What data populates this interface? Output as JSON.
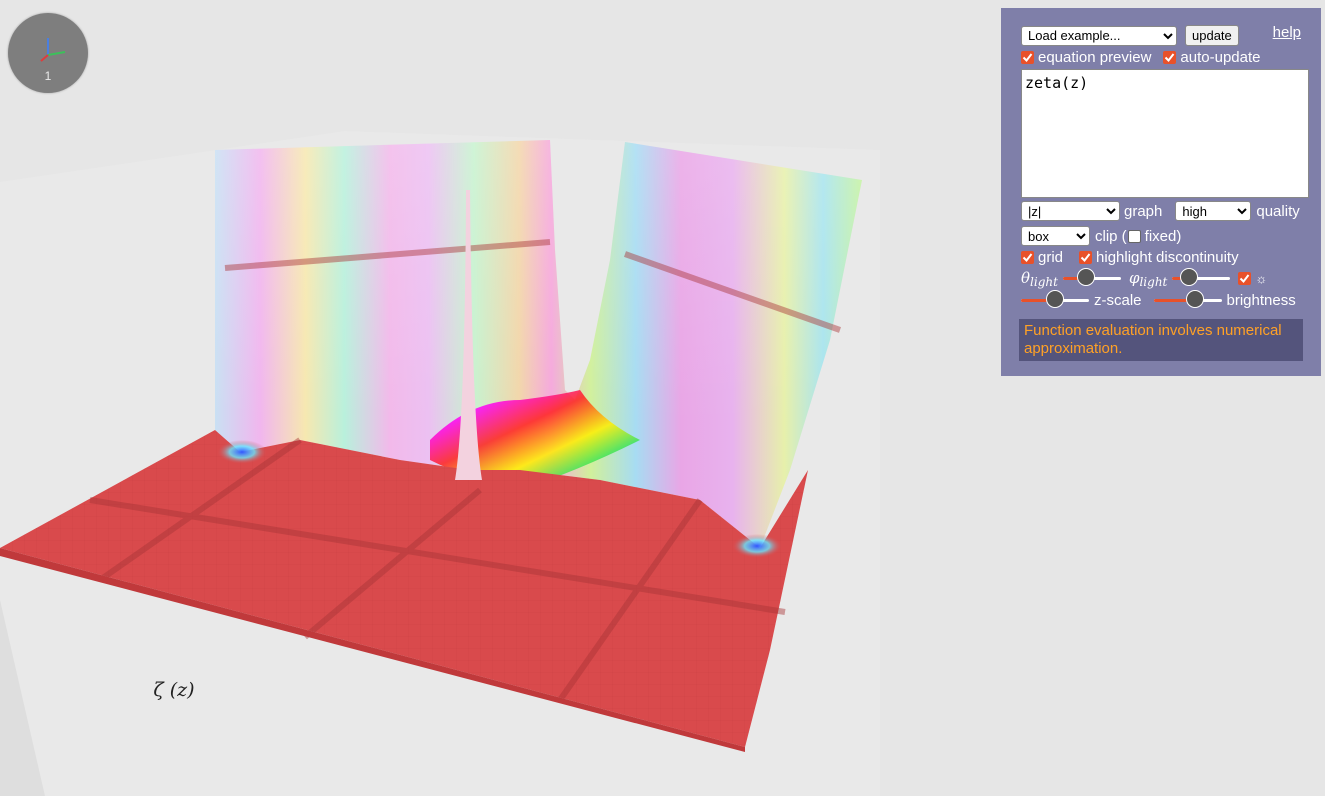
{
  "gizmo": {
    "zoom": "1"
  },
  "plot": {
    "equation_label": "ζ (z)",
    "floor_color": "#d94a4c",
    "background_color": "#e6e6e6"
  },
  "panel": {
    "bg_color": "#7f7fa9",
    "accent_color": "#e8512a",
    "help": "help",
    "example_select": "Load example...",
    "update_button": "update",
    "equation_preview": {
      "label": "equation preview",
      "checked": true
    },
    "auto_update": {
      "label": "auto-update",
      "checked": true
    },
    "equation": "zeta(z)",
    "graph_mode": {
      "value": "|z|",
      "label": "graph"
    },
    "quality": {
      "value": "high",
      "label": "quality"
    },
    "clip": {
      "value": "box",
      "label_before": "clip (",
      "fixed_label": "fixed)",
      "fixed_checked": false
    },
    "grid": {
      "label": "grid",
      "checked": true
    },
    "highlight_discontinuity": {
      "label": "highlight discontinuity",
      "checked": true
    },
    "theta_light": {
      "symbol": "θ",
      "subscript": "light",
      "value": 0.35
    },
    "phi_light": {
      "symbol": "φ",
      "subscript": "light",
      "value": 0.2
    },
    "sun_toggle": {
      "checked": true,
      "glyph": "☼"
    },
    "z_scale": {
      "label": "z-scale",
      "value": 0.5
    },
    "brightness": {
      "label": "brightness",
      "value": 0.65
    },
    "warning": "Function evaluation involves numerical approximation."
  }
}
